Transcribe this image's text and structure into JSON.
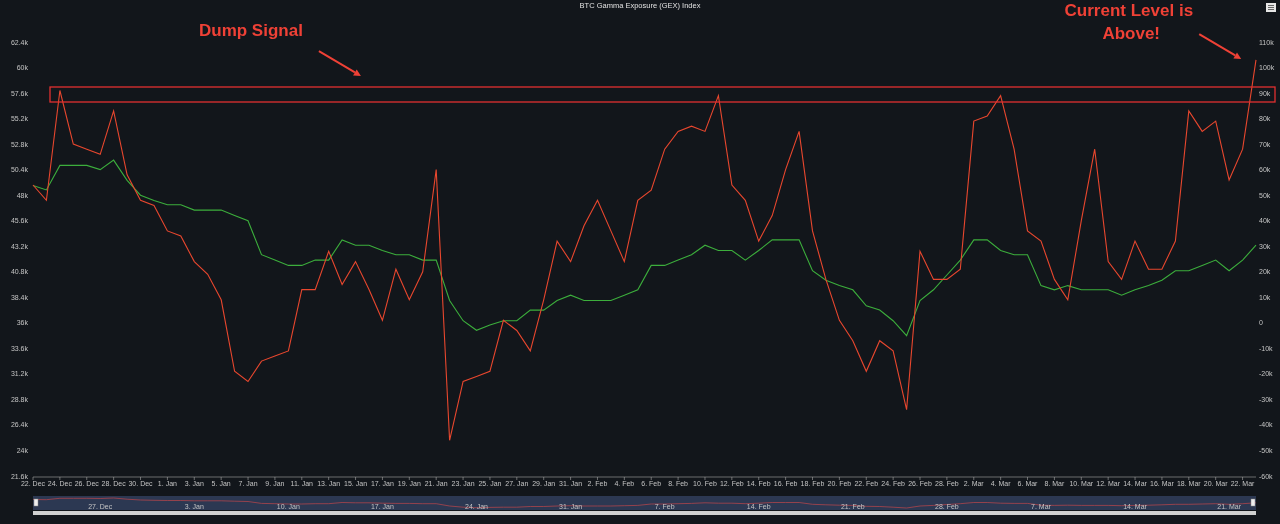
{
  "chart": {
    "chart_data": {
      "type": "line",
      "title": "BTC Gamma Exposure (GEX) Index",
      "categories": [
        "22. Dec",
        null,
        "24. Dec",
        null,
        "26. Dec",
        null,
        "28. Dec",
        null,
        "30. Dec",
        null,
        "1. Jan",
        null,
        "3. Jan",
        null,
        "5. Jan",
        null,
        "7. Jan",
        null,
        "9. Jan",
        null,
        "11. Jan",
        null,
        "13. Jan",
        null,
        "15. Jan",
        null,
        "17. Jan",
        null,
        "19. Jan",
        null,
        "21. Jan",
        null,
        "23. Jan",
        null,
        "25. Jan",
        null,
        "27. Jan",
        null,
        "29. Jan",
        null,
        "31. Jan",
        null,
        "2. Feb",
        null,
        "4. Feb",
        null,
        "6. Feb",
        null,
        "8. Feb",
        null,
        "10. Feb",
        null,
        "12. Feb",
        null,
        "14. Feb",
        null,
        "16. Feb",
        null,
        "18. Feb",
        null,
        "20. Feb",
        null,
        "22. Feb",
        null,
        "24. Feb",
        null,
        "26. Feb",
        null,
        "28. Feb",
        null,
        "2. Mar",
        null,
        "4. Mar",
        null,
        "6. Mar",
        null,
        "8. Mar",
        null,
        "10. Mar",
        null,
        "12. Mar",
        null,
        "14. Mar",
        null,
        "16. Mar",
        null,
        "18. Mar",
        null,
        "20. Mar",
        null,
        "22. Mar",
        null
      ],
      "ylim": [
        21.6,
        62.4
      ],
      "y2lim": [
        -60,
        110
      ],
      "series": [
        {
          "color": "#e8472e",
          "axis": "y2",
          "values": [
            54,
            48,
            91,
            70,
            68,
            66,
            83,
            58,
            48,
            46,
            36,
            34,
            24,
            19,
            9,
            -19,
            -23,
            -15,
            -13,
            -11,
            13,
            13,
            28,
            15,
            24,
            13,
            1,
            21,
            9,
            20,
            60,
            -46,
            -23,
            -21,
            -19,
            1,
            -3,
            -11,
            9,
            32,
            24,
            38,
            48,
            36,
            24,
            48,
            52,
            68,
            75,
            77,
            75,
            89,
            54,
            48,
            32,
            42,
            60,
            75,
            36,
            17,
            1,
            -7,
            -19,
            -7,
            -11,
            -34,
            28,
            17,
            17,
            21,
            79,
            81,
            89,
            68,
            36,
            32,
            17,
            9,
            40,
            68,
            24,
            17,
            32,
            21,
            21,
            32,
            83,
            75,
            79,
            56,
            68,
            103
          ]
        },
        {
          "color": "#3cae3c",
          "values": [
            48.9,
            48.5,
            50.8,
            50.8,
            50.8,
            50.4,
            51.3,
            49.4,
            48.0,
            47.5,
            47.1,
            47.1,
            46.6,
            46.6,
            46.6,
            46.1,
            45.6,
            42.4,
            41.9,
            41.4,
            41.4,
            41.9,
            41.9,
            43.8,
            43.3,
            43.3,
            42.8,
            42.4,
            42.4,
            41.9,
            41.9,
            38.1,
            36.2,
            35.3,
            35.8,
            36.2,
            36.2,
            37.2,
            37.2,
            38.1,
            38.6,
            38.1,
            38.1,
            38.1,
            38.6,
            39.1,
            41.4,
            41.4,
            41.9,
            42.4,
            43.3,
            42.8,
            42.8,
            41.9,
            42.8,
            43.8,
            43.8,
            43.8,
            40.9,
            40.0,
            39.5,
            39.1,
            37.6,
            37.2,
            36.2,
            34.8,
            38.1,
            39.1,
            40.5,
            41.9,
            43.8,
            43.8,
            42.8,
            42.4,
            42.4,
            39.5,
            39.1,
            39.5,
            39.1,
            39.1,
            39.1,
            38.6,
            39.1,
            39.5,
            40.0,
            40.9,
            40.9,
            41.4,
            41.9,
            40.9,
            41.9,
            43.3
          ]
        }
      ],
      "yticks": [
        {
          "value": 62.4,
          "label": "62.4k"
        },
        {
          "value": 60,
          "label": "60k"
        },
        {
          "value": 57.6,
          "label": "57.6k"
        },
        {
          "value": 55.2,
          "label": "55.2k"
        },
        {
          "value": 52.8,
          "label": "52.8k"
        },
        {
          "value": 50.4,
          "label": "50.4k"
        },
        {
          "value": 48,
          "label": "48k"
        },
        {
          "value": 45.6,
          "label": "45.6k"
        },
        {
          "value": 43.2,
          "label": "43.2k"
        },
        {
          "value": 40.8,
          "label": "40.8k"
        },
        {
          "value": 38.4,
          "label": "38.4k"
        },
        {
          "value": 36,
          "label": "36k"
        },
        {
          "value": 33.6,
          "label": "33.6k"
        },
        {
          "value": 31.2,
          "label": "31.2k"
        },
        {
          "value": 28.8,
          "label": "28.8k"
        },
        {
          "value": 26.4,
          "label": "26.4k"
        },
        {
          "value": 24,
          "label": "24k"
        },
        {
          "value": 21.6,
          "label": "21.6k"
        }
      ],
      "y2ticks": [
        {
          "value": 110,
          "label": "110k"
        },
        {
          "value": 100,
          "label": "100k"
        },
        {
          "value": 90,
          "label": "90k"
        },
        {
          "value": 80,
          "label": "80k"
        },
        {
          "value": 70,
          "label": "70k"
        },
        {
          "value": 60,
          "label": "60k"
        },
        {
          "value": 50,
          "label": "50k"
        },
        {
          "value": 40,
          "label": "40k"
        },
        {
          "value": 30,
          "label": "30k"
        },
        {
          "value": 20,
          "label": "20k"
        },
        {
          "value": 10,
          "label": "10k"
        },
        {
          "value": 0,
          "label": "0"
        },
        {
          "value": -10,
          "label": "-10k"
        },
        {
          "value": -20,
          "label": "-20k"
        },
        {
          "value": -30,
          "label": "-30k"
        },
        {
          "value": -40,
          "label": "-40k"
        },
        {
          "value": -50,
          "label": "-50k"
        },
        {
          "value": -60,
          "label": "-60k"
        }
      ],
      "annotations": [
        "Dump Signal",
        "Current Level is Above!"
      ]
    }
  },
  "navigator": {
    "labels": [
      "27. Dec",
      "3. Jan",
      "10. Jan",
      "17. Jan",
      "24. Jan",
      "31. Jan",
      "7. Feb",
      "14. Feb",
      "21. Feb",
      "28. Feb",
      "7. Mar",
      "14. Mar",
      "21. Mar"
    ]
  }
}
